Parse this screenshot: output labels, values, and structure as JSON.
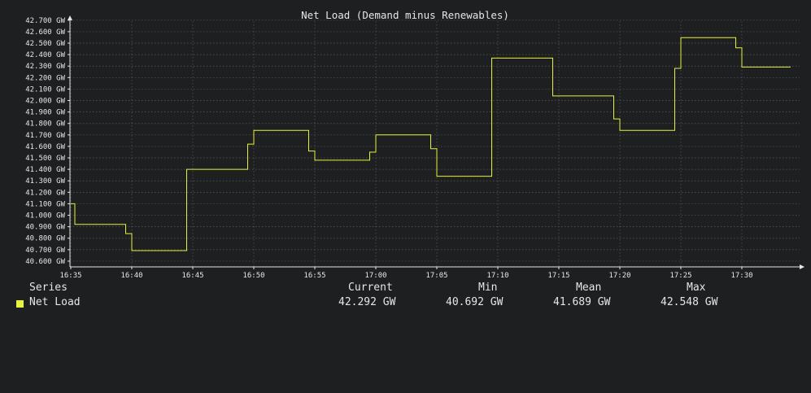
{
  "chart_data": {
    "type": "line",
    "title": "Net Load (Demand minus Renewables)",
    "unit": "GW",
    "x_ticks": [
      "16:35",
      "16:40",
      "16:45",
      "16:50",
      "16:55",
      "17:00",
      "17:05",
      "17:10",
      "17:15",
      "17:20",
      "17:25",
      "17:30"
    ],
    "y_ticks": [
      "40.600 GW",
      "40.700 GW",
      "40.800 GW",
      "40.900 GW",
      "41.000 GW",
      "41.100 GW",
      "41.200 GW",
      "41.300 GW",
      "41.400 GW",
      "41.500 GW",
      "41.600 GW",
      "41.700 GW",
      "41.800 GW",
      "41.900 GW",
      "42.000 GW",
      "42.100 GW",
      "42.200 GW",
      "42.300 GW",
      "42.400 GW",
      "42.500 GW",
      "42.600 GW",
      "42.700 GW"
    ],
    "xlim": [
      "16:35",
      "17:34"
    ],
    "ylim": [
      40.55,
      42.72
    ],
    "grid": true,
    "color": "#e6f23c",
    "series": [
      {
        "name": "Net Load",
        "step": true,
        "points": [
          [
            "16:35:00",
            41.1
          ],
          [
            "16:35:20",
            40.92
          ],
          [
            "16:39:30",
            40.84
          ],
          [
            "16:40:00",
            40.692
          ],
          [
            "16:44:30",
            41.4
          ],
          [
            "16:49:30",
            41.62
          ],
          [
            "16:50:00",
            41.74
          ],
          [
            "16:54:30",
            41.56
          ],
          [
            "16:55:00",
            41.48
          ],
          [
            "16:59:30",
            41.55
          ],
          [
            "17:00:00",
            41.7
          ],
          [
            "17:04:30",
            41.58
          ],
          [
            "17:05:00",
            41.34
          ],
          [
            "17:09:30",
            42.37
          ],
          [
            "17:14:30",
            42.04
          ],
          [
            "17:19:30",
            41.84
          ],
          [
            "17:20:00",
            41.74
          ],
          [
            "17:24:30",
            42.28
          ],
          [
            "17:25:00",
            42.548
          ],
          [
            "17:29:30",
            42.46
          ],
          [
            "17:30:00",
            42.292
          ],
          [
            "17:34:00",
            42.292
          ]
        ]
      }
    ]
  },
  "legend": {
    "header": {
      "series": "Series",
      "current": "Current",
      "min": "Min",
      "mean": "Mean",
      "max": "Max"
    },
    "rows": [
      {
        "name": "Net Load",
        "current": "42.292 GW",
        "min": "40.692 GW",
        "mean": "41.689 GW",
        "max": "42.548 GW",
        "color": "#e6f23c"
      }
    ]
  }
}
